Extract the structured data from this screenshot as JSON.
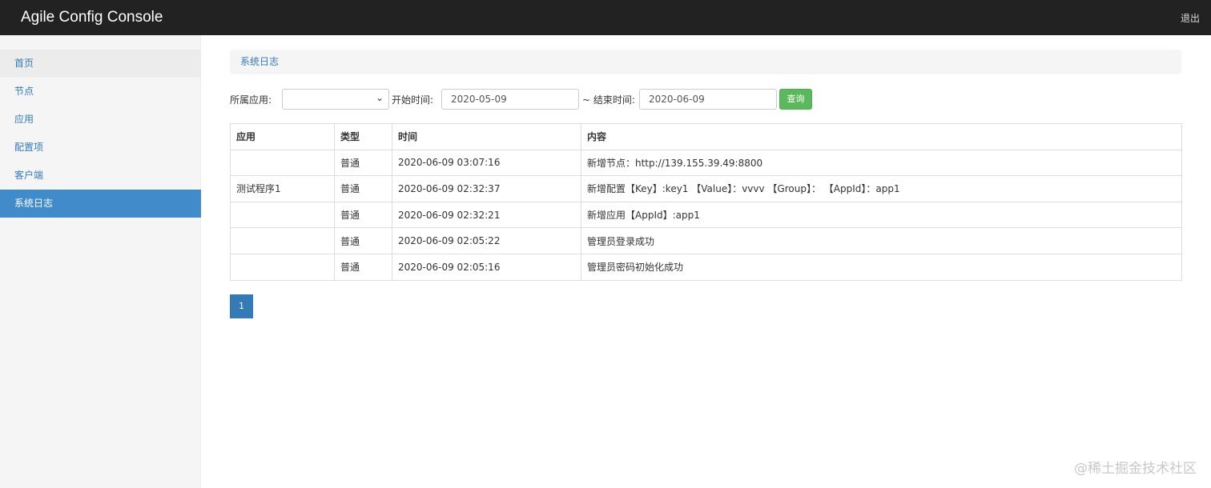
{
  "app": {
    "title": "Agile Config Console",
    "logout": "退出"
  },
  "sidebar": {
    "items": [
      {
        "label": "首页"
      },
      {
        "label": "节点"
      },
      {
        "label": "应用"
      },
      {
        "label": "配置项"
      },
      {
        "label": "客户端"
      },
      {
        "label": "系统日志"
      }
    ]
  },
  "breadcrumb": "系统日志",
  "filters": {
    "app_label": "所属应用:",
    "app_value": "",
    "start_label": "开始时间:",
    "start_value": "2020-05-09",
    "end_label": "~ 结束时间:",
    "end_value": "2020-06-09",
    "query_label": "查询"
  },
  "table": {
    "headers": [
      "应用",
      "类型",
      "时间",
      "内容"
    ],
    "rows": [
      [
        "",
        "普通",
        "2020-06-09 03:07:16",
        "新增节点：http://139.155.39.49:8800"
      ],
      [
        "测试程序1",
        "普通",
        "2020-06-09 02:32:37",
        "新增配置【Key】:key1 【Value】：vvvv 【Group】：  【AppId】：app1"
      ],
      [
        "",
        "普通",
        "2020-06-09 02:32:21",
        "新增应用【AppId】:app1"
      ],
      [
        "",
        "普通",
        "2020-06-09 02:05:22",
        "管理员登录成功"
      ],
      [
        "",
        "普通",
        "2020-06-09 02:05:16",
        "管理员密码初始化成功"
      ]
    ]
  },
  "pagination": {
    "current": "1"
  },
  "watermark": "@稀土掘金技术社区",
  "colors": {
    "topbar": "#222222",
    "active_nav": "#428bca",
    "query_button": "#5cb85c",
    "link": "#337ab7"
  }
}
